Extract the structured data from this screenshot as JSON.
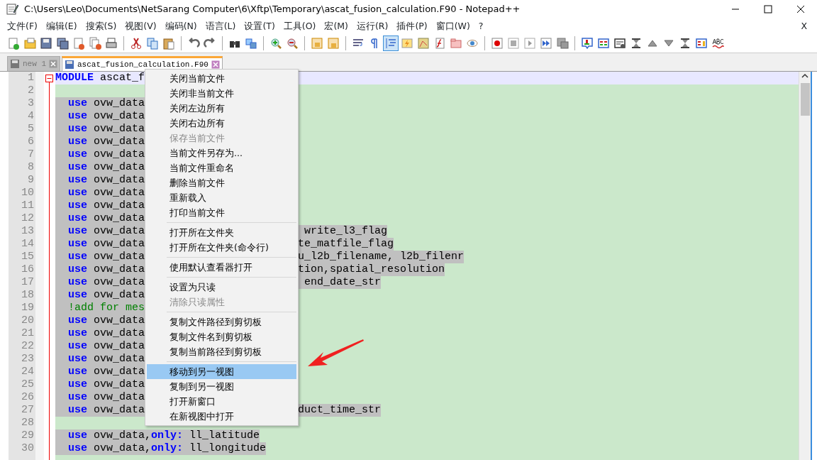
{
  "window": {
    "title": "C:\\Users\\Leo\\Documents\\NetSarang Computer\\6\\Xftp\\Temporary\\ascat_fusion_calculation.F90 - Notepad++"
  },
  "menu_bar": {
    "items": [
      "文件(F)",
      "编辑(E)",
      "搜索(S)",
      "视图(V)",
      "编码(N)",
      "语言(L)",
      "设置(T)",
      "工具(O)",
      "宏(M)",
      "运行(R)",
      "插件(P)",
      "窗口(W)",
      "?"
    ],
    "close_doc": "X"
  },
  "toolbar": {
    "groups": [
      [
        {
          "selected": false
        },
        {
          "selected": false
        },
        {
          "selected": false
        },
        {
          "selected": false
        },
        {
          "selected": false
        },
        {
          "selected": false
        },
        {
          "selected": false
        }
      ],
      [
        {
          "selected": false
        },
        {
          "selected": false
        },
        {
          "selected": false
        }
      ],
      [
        {
          "selected": false
        },
        {
          "selected": false
        }
      ],
      [
        {
          "selected": false
        },
        {
          "selected": false
        }
      ],
      [
        {
          "selected": false
        },
        {
          "selected": false
        }
      ],
      [
        {
          "selected": false
        },
        {
          "selected": false
        }
      ],
      [
        {
          "selected": false
        },
        {
          "selected": false
        },
        {
          "selected": true
        },
        {
          "selected": false
        },
        {
          "selected": false
        },
        {
          "selected": false
        },
        {
          "selected": false
        },
        {
          "selected": false
        }
      ],
      [
        {
          "selected": false
        },
        {
          "selected": false
        },
        {
          "selected": false
        },
        {
          "selected": false
        },
        {
          "selected": false
        }
      ],
      [
        {
          "selected": false
        },
        {
          "selected": false
        },
        {
          "selected": false
        },
        {
          "selected": false
        },
        {
          "selected": false
        },
        {
          "selected": false
        },
        {
          "selected": false
        },
        {
          "selected": false
        },
        {
          "selected": false
        }
      ]
    ]
  },
  "tabs": [
    {
      "label": "new 1",
      "selected": false
    },
    {
      "label": "ascat_fusion_calculation.F90",
      "selected": true
    }
  ],
  "editor": {
    "lines": [
      {
        "number": "1",
        "current": true,
        "left": [
          {
            "text": "MODULE",
            "kind": "keyword"
          },
          {
            "text": " ascat_f",
            "kind": "plain"
          }
        ]
      },
      {
        "number": "2"
      },
      {
        "number": "3",
        "left": [
          {
            "text": "  use",
            "kind": "keyword"
          },
          {
            "text": " ovw_data",
            "kind": "plain"
          }
        ]
      },
      {
        "number": "4",
        "left": [
          {
            "text": "  use",
            "kind": "keyword"
          },
          {
            "text": " ovw_data",
            "kind": "plain"
          }
        ]
      },
      {
        "number": "5",
        "left": [
          {
            "text": "  use",
            "kind": "keyword"
          },
          {
            "text": " ovw_data",
            "kind": "plain"
          }
        ]
      },
      {
        "number": "6",
        "left": [
          {
            "text": "  use",
            "kind": "keyword"
          },
          {
            "text": " ovw_data",
            "kind": "plain"
          }
        ]
      },
      {
        "number": "7",
        "left": [
          {
            "text": "  use",
            "kind": "keyword"
          },
          {
            "text": " ovw_data",
            "kind": "plain"
          }
        ]
      },
      {
        "number": "8",
        "left": [
          {
            "text": "  use",
            "kind": "keyword"
          },
          {
            "text": " ovw_data",
            "kind": "plain"
          }
        ]
      },
      {
        "number": "9",
        "left": [
          {
            "text": "  use",
            "kind": "keyword"
          },
          {
            "text": " ovw_data",
            "kind": "plain"
          }
        ]
      },
      {
        "number": "10",
        "left": [
          {
            "text": "  use",
            "kind": "keyword"
          },
          {
            "text": " ovw_data",
            "kind": "plain"
          }
        ]
      },
      {
        "number": "11",
        "left": [
          {
            "text": "  use",
            "kind": "keyword"
          },
          {
            "text": " ovw_data",
            "kind": "plain"
          }
        ]
      },
      {
        "number": "12",
        "left": [
          {
            "text": "  use",
            "kind": "keyword"
          },
          {
            "text": " ovw_data",
            "kind": "plain"
          }
        ]
      },
      {
        "number": "13",
        "left": [
          {
            "text": "  use",
            "kind": "keyword"
          },
          {
            "text": " ovw_data",
            "kind": "plain"
          }
        ],
        "right": " write_l3_flag"
      },
      {
        "number": "14",
        "left": [
          {
            "text": "  use",
            "kind": "keyword"
          },
          {
            "text": " ovw_data",
            "kind": "plain"
          }
        ],
        "right": "te_matfile_flag"
      },
      {
        "number": "15",
        "left": [
          {
            "text": "  use",
            "kind": "keyword"
          },
          {
            "text": " ovw_data",
            "kind": "plain"
          }
        ],
        "right": "u_l2b_filename, l2b_filenr"
      },
      {
        "number": "16",
        "left": [
          {
            "text": "  use",
            "kind": "keyword"
          },
          {
            "text": " ovw_data",
            "kind": "plain"
          }
        ],
        "right": "tion,spatial_resolution"
      },
      {
        "number": "17",
        "left": [
          {
            "text": "  use",
            "kind": "keyword"
          },
          {
            "text": " ovw_data",
            "kind": "plain"
          }
        ],
        "right": " end_date_str"
      },
      {
        "number": "18",
        "left": [
          {
            "text": "  use",
            "kind": "keyword"
          },
          {
            "text": " ovw_data",
            "kind": "plain"
          }
        ]
      },
      {
        "number": "19",
        "left": [
          {
            "text": "  !add for mes",
            "kind": "comment"
          }
        ]
      },
      {
        "number": "20",
        "left": [
          {
            "text": "  use",
            "kind": "keyword"
          },
          {
            "text": " ovw_data",
            "kind": "plain"
          }
        ]
      },
      {
        "number": "21",
        "left": [
          {
            "text": "  use",
            "kind": "keyword"
          },
          {
            "text": " ovw_data",
            "kind": "plain"
          }
        ]
      },
      {
        "number": "22",
        "left": [
          {
            "text": "  use",
            "kind": "keyword"
          },
          {
            "text": " ovw_data",
            "kind": "plain"
          }
        ]
      },
      {
        "number": "23",
        "left": [
          {
            "text": "  use",
            "kind": "keyword"
          },
          {
            "text": " ovw_data",
            "kind": "plain"
          }
        ]
      },
      {
        "number": "24",
        "left": [
          {
            "text": "  use",
            "kind": "keyword"
          },
          {
            "text": " ovw_data",
            "kind": "plain"
          }
        ]
      },
      {
        "number": "25",
        "left": [
          {
            "text": "  use",
            "kind": "keyword"
          },
          {
            "text": " ovw_data",
            "kind": "plain"
          }
        ]
      },
      {
        "number": "26",
        "left": [
          {
            "text": "  use",
            "kind": "keyword"
          },
          {
            "text": " ovw_data",
            "kind": "plain"
          }
        ]
      },
      {
        "number": "27",
        "left": [
          {
            "text": "  use",
            "kind": "keyword"
          },
          {
            "text": " ovw_data",
            "kind": "plain"
          }
        ],
        "right": "duct_time_str"
      },
      {
        "number": "28"
      },
      {
        "number": "29",
        "left": [
          {
            "text": "  use",
            "kind": "keyword"
          },
          {
            "text": " ovw_data,",
            "kind": "plain"
          },
          {
            "text": "only:",
            "kind": "keyword"
          },
          {
            "text": " ll_latitude",
            "kind": "plain"
          }
        ]
      },
      {
        "number": "30",
        "left": [
          {
            "text": "  use",
            "kind": "keyword"
          },
          {
            "text": " ovw_data,",
            "kind": "plain"
          },
          {
            "text": "only:",
            "kind": "keyword"
          },
          {
            "text": " ll_longitude",
            "kind": "plain"
          }
        ]
      }
    ]
  },
  "context_menu": {
    "items": [
      {
        "kind": "item",
        "label": "关闭当前文件",
        "disabled": false,
        "selected": false
      },
      {
        "kind": "item",
        "label": "关闭非当前文件",
        "disabled": false,
        "selected": false
      },
      {
        "kind": "item",
        "label": "关闭左边所有",
        "disabled": false,
        "selected": false
      },
      {
        "kind": "item",
        "label": "关闭右边所有",
        "disabled": false,
        "selected": false
      },
      {
        "kind": "item",
        "label": "保存当前文件",
        "disabled": true,
        "selected": false
      },
      {
        "kind": "item",
        "label": "当前文件另存为...",
        "disabled": false,
        "selected": false
      },
      {
        "kind": "item",
        "label": "当前文件重命名",
        "disabled": false,
        "selected": false
      },
      {
        "kind": "item",
        "label": "删除当前文件",
        "disabled": false,
        "selected": false
      },
      {
        "kind": "item",
        "label": "重新载入",
        "disabled": false,
        "selected": false
      },
      {
        "kind": "item",
        "label": "打印当前文件",
        "disabled": false,
        "selected": false
      },
      {
        "kind": "separator"
      },
      {
        "kind": "item",
        "label": "打开所在文件夹",
        "disabled": false,
        "selected": false
      },
      {
        "kind": "item",
        "label": "打开所在文件夹(命令行)",
        "disabled": false,
        "selected": false
      },
      {
        "kind": "separator"
      },
      {
        "kind": "item",
        "label": "使用默认查看器打开",
        "disabled": false,
        "selected": false
      },
      {
        "kind": "separator"
      },
      {
        "kind": "item",
        "label": "设置为只读",
        "disabled": false,
        "selected": false
      },
      {
        "kind": "item",
        "label": "清除只读属性",
        "disabled": true,
        "selected": false
      },
      {
        "kind": "separator"
      },
      {
        "kind": "item",
        "label": "复制文件路径到剪切板",
        "disabled": false,
        "selected": false
      },
      {
        "kind": "item",
        "label": "复制文件名到剪切板",
        "disabled": false,
        "selected": false
      },
      {
        "kind": "item",
        "label": "复制当前路径到剪切板",
        "disabled": false,
        "selected": false
      },
      {
        "kind": "separator"
      },
      {
        "kind": "item",
        "label": "移动到另一视图",
        "disabled": false,
        "selected": true
      },
      {
        "kind": "item",
        "label": "复制到另一视图",
        "disabled": false,
        "selected": false
      },
      {
        "kind": "item",
        "label": "打开新窗口",
        "disabled": false,
        "selected": false
      },
      {
        "kind": "item",
        "label": "在新视图中打开",
        "disabled": false,
        "selected": false
      }
    ]
  }
}
